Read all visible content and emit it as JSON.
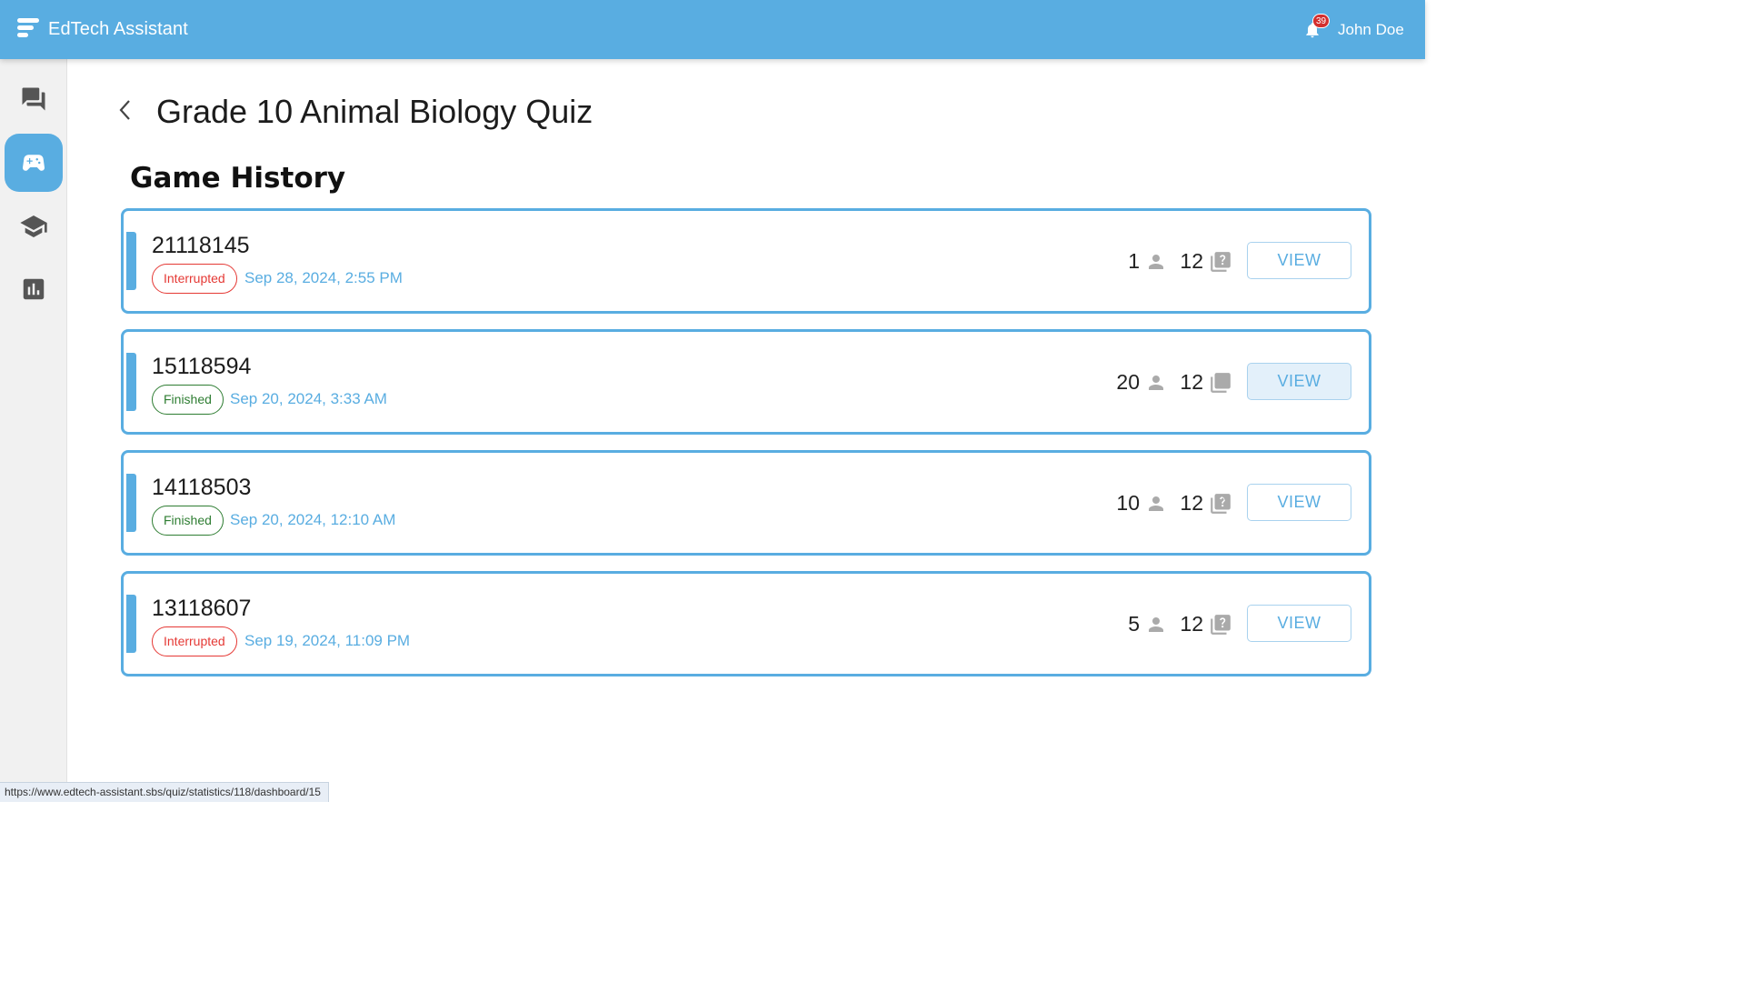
{
  "header": {
    "app_title": "EdTech Assistant",
    "notification_count": "39",
    "user_name": "John Doe",
    "brand_color": "#59ade1"
  },
  "sidebar": {
    "items": [
      {
        "icon": "chat-icon",
        "active": false
      },
      {
        "icon": "gamepad-icon",
        "active": true
      },
      {
        "icon": "graduation-cap-icon",
        "active": false
      },
      {
        "icon": "bar-chart-icon",
        "active": false
      }
    ]
  },
  "page": {
    "title": "Grade 10 Animal Biology Quiz",
    "section_title": "Game History"
  },
  "games": [
    {
      "id": "21118145",
      "status": "Interrupted",
      "date": "Sep 28, 2024, 2:55 PM",
      "players": "1",
      "questions": "12",
      "view_label": "VIEW"
    },
    {
      "id": "15118594",
      "status": "Finished",
      "date": "Sep 20, 2024, 3:33 AM",
      "players": "20",
      "questions": "12",
      "view_label": "VIEW"
    },
    {
      "id": "14118503",
      "status": "Finished",
      "date": "Sep 20, 2024, 12:10 AM",
      "players": "10",
      "questions": "12",
      "view_label": "VIEW"
    },
    {
      "id": "13118607",
      "status": "Interrupted",
      "date": "Sep 19, 2024, 11:09 PM",
      "players": "5",
      "questions": "12",
      "view_label": "VIEW"
    }
  ],
  "browser_status_url": "https://www.edtech-assistant.sbs/quiz/statistics/118/dashboard/15"
}
